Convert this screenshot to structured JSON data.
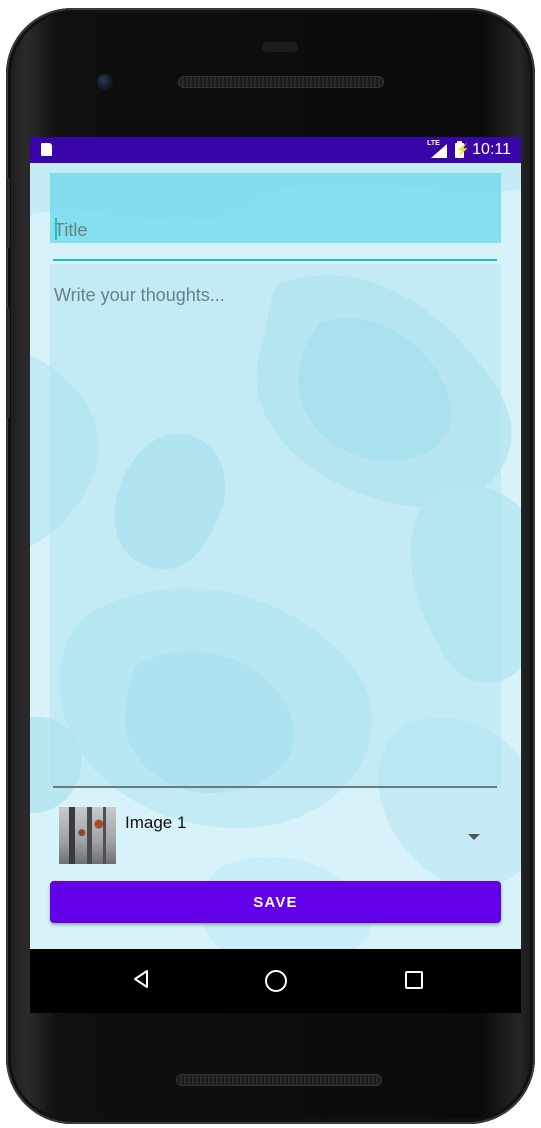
{
  "statusbar": {
    "time": "10:11",
    "network": "LTE",
    "icons": [
      "sd-card-icon",
      "lte-signal-icon",
      "battery-charging-icon"
    ]
  },
  "note_editor": {
    "title_placeholder": "Title",
    "title_value": "",
    "body_placeholder": "Write your thoughts...",
    "body_value": "",
    "image_spinner": {
      "selected_label": "Image 1",
      "icon": "chevron-down-icon"
    },
    "save_label": "SAVE"
  },
  "colors": {
    "status_bar": "#3a05a8",
    "accent": "#6200ea",
    "title_underline": "#1fc1b0",
    "background": "#d4f2f8"
  },
  "navigation": {
    "icons": [
      "back-icon",
      "home-icon",
      "recents-icon"
    ]
  }
}
